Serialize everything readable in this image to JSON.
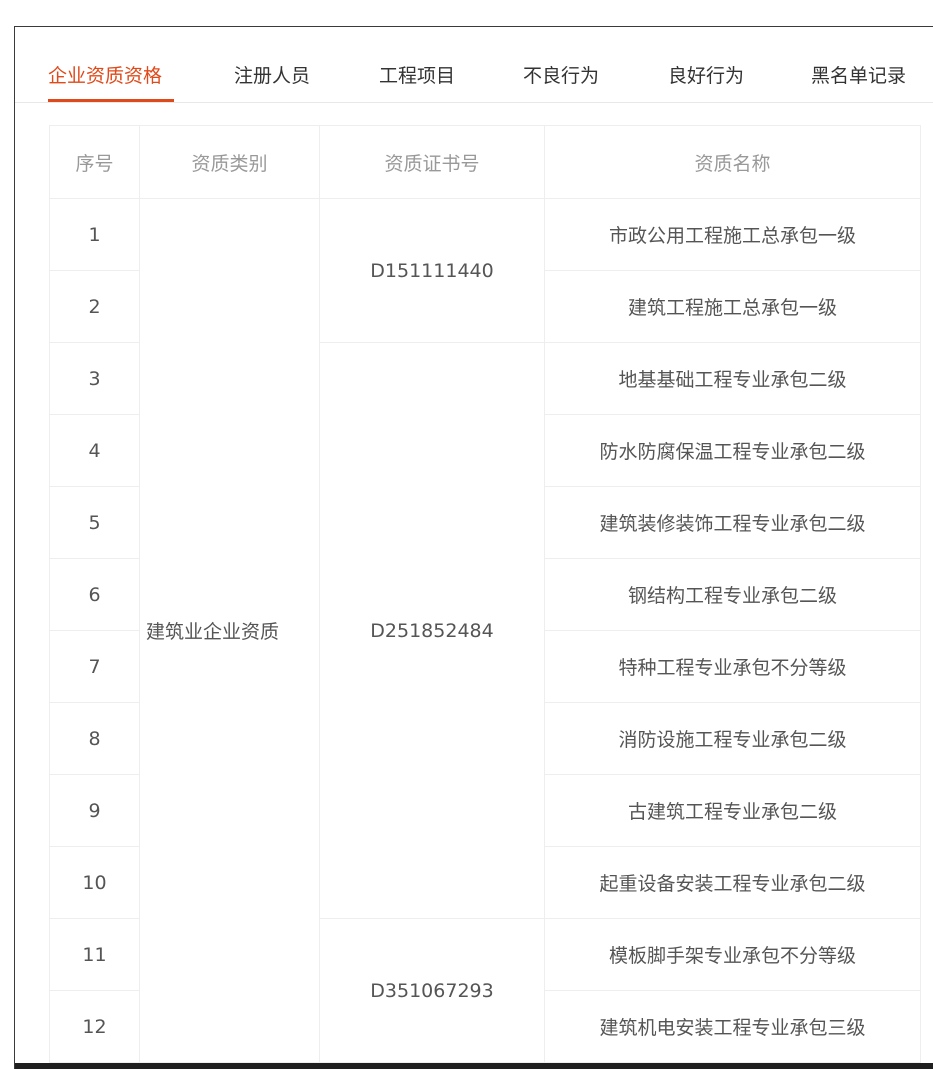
{
  "tabs": [
    {
      "label": "企业资质资格",
      "active": true
    },
    {
      "label": "注册人员",
      "active": false
    },
    {
      "label": "工程项目",
      "active": false
    },
    {
      "label": "不良行为",
      "active": false
    },
    {
      "label": "良好行为",
      "active": false
    },
    {
      "label": "黑名单记录",
      "active": false
    }
  ],
  "table": {
    "headers": [
      "序号",
      "资质类别",
      "资质证书号",
      "资质名称"
    ],
    "category": "建筑业企业资质",
    "certificates": [
      "D151111440",
      "D251852484",
      "D351067293"
    ],
    "rows": [
      {
        "no": "1",
        "name": "市政公用工程施工总承包一级"
      },
      {
        "no": "2",
        "name": "建筑工程施工总承包一级"
      },
      {
        "no": "3",
        "name": "地基基础工程专业承包二级"
      },
      {
        "no": "4",
        "name": "防水防腐保温工程专业承包二级"
      },
      {
        "no": "5",
        "name": "建筑装修装饰工程专业承包二级"
      },
      {
        "no": "6",
        "name": "钢结构工程专业承包二级"
      },
      {
        "no": "7",
        "name": "特种工程专业承包不分等级"
      },
      {
        "no": "8",
        "name": "消防设施工程专业承包二级"
      },
      {
        "no": "9",
        "name": "古建筑工程专业承包二级"
      },
      {
        "no": "10",
        "name": "起重设备安装工程专业承包二级"
      },
      {
        "no": "11",
        "name": "模板脚手架专业承包不分等级"
      },
      {
        "no": "12",
        "name": "建筑机电安装工程专业承包三级"
      }
    ]
  },
  "colors": {
    "accent": "#e0491a",
    "header_text": "#999999",
    "cell_text": "#555555",
    "border": "#eeeeee"
  }
}
